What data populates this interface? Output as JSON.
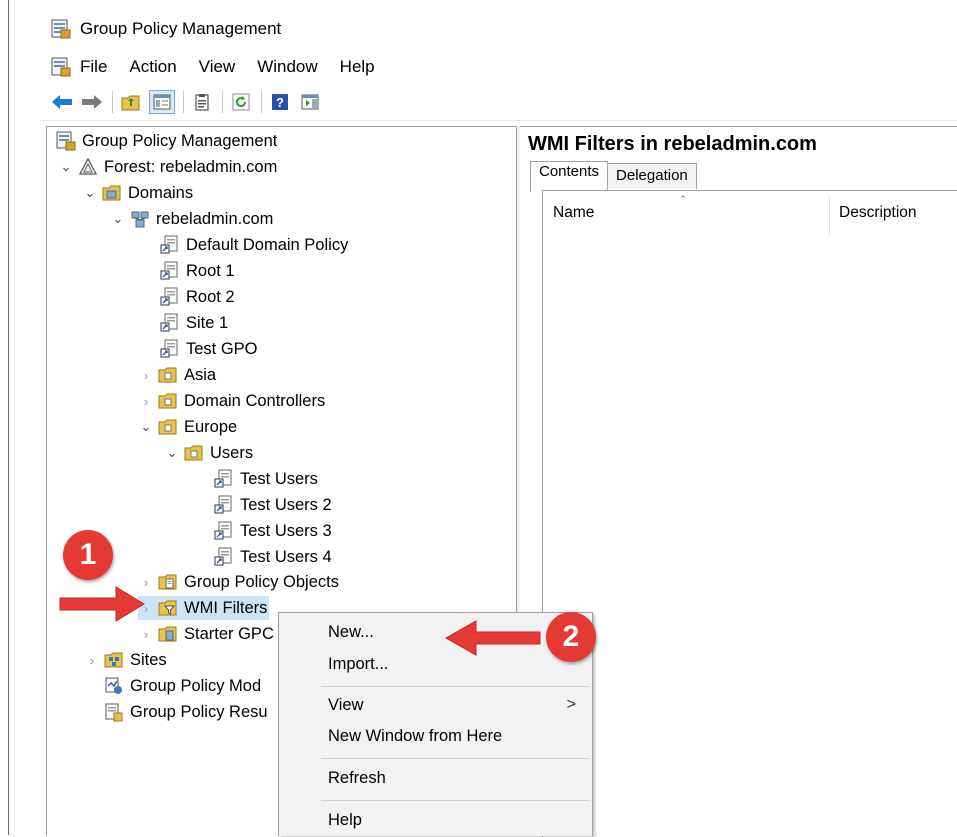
{
  "window": {
    "title": "Group Policy Management"
  },
  "menubar": [
    "File",
    "Action",
    "View",
    "Window",
    "Help"
  ],
  "tree": {
    "items": [
      {
        "label": "Group Policy Management",
        "icon": "gpm-console-icon"
      },
      {
        "label": "Forest: rebeladmin.com",
        "icon": "forest-icon"
      },
      {
        "label": "Domains",
        "icon": "domains-icon"
      },
      {
        "label": "rebeladmin.com",
        "icon": "domain-icon"
      },
      {
        "label": "Default Domain Policy",
        "icon": "gpo-link-icon"
      },
      {
        "label": "Root 1",
        "icon": "gpo-link-icon"
      },
      {
        "label": "Root 2",
        "icon": "gpo-link-icon"
      },
      {
        "label": "Site 1",
        "icon": "gpo-link-icon"
      },
      {
        "label": "Test GPO",
        "icon": "gpo-link-icon"
      },
      {
        "label": "Asia",
        "icon": "ou-folder-icon"
      },
      {
        "label": "Domain Controllers",
        "icon": "ou-folder-icon"
      },
      {
        "label": "Europe",
        "icon": "ou-folder-icon"
      },
      {
        "label": "Users",
        "icon": "ou-folder-icon"
      },
      {
        "label": "Test Users",
        "icon": "gpo-link-icon"
      },
      {
        "label": "Test Users 2",
        "icon": "gpo-link-icon"
      },
      {
        "label": "Test Users 3",
        "icon": "gpo-link-icon"
      },
      {
        "label": "Test Users 4",
        "icon": "gpo-link-icon"
      },
      {
        "label": "Group Policy Objects",
        "icon": "gpo-folder-icon"
      },
      {
        "label": "WMI Filters",
        "icon": "wmi-filter-folder-icon"
      },
      {
        "label": "Starter GPC",
        "icon": "starter-gpo-folder-icon"
      },
      {
        "label": "Sites",
        "icon": "sites-icon"
      },
      {
        "label": "Group Policy Mod",
        "icon": "gp-modeling-icon"
      },
      {
        "label": "Group Policy Resu",
        "icon": "gp-results-icon"
      }
    ]
  },
  "right_pane": {
    "title": "WMI Filters in rebeladmin.com",
    "tabs": [
      "Contents",
      "Delegation"
    ],
    "columns": [
      "Name",
      "Description"
    ]
  },
  "context_menu": {
    "items": [
      "New...",
      "Import...",
      "View",
      "New Window from Here",
      "Refresh",
      "Help"
    ],
    "submenu_arrow": ">"
  },
  "callouts": [
    "1",
    "2"
  ],
  "colors": {
    "callout": "#e53935",
    "nav_arrow": "#1e7bd4"
  }
}
